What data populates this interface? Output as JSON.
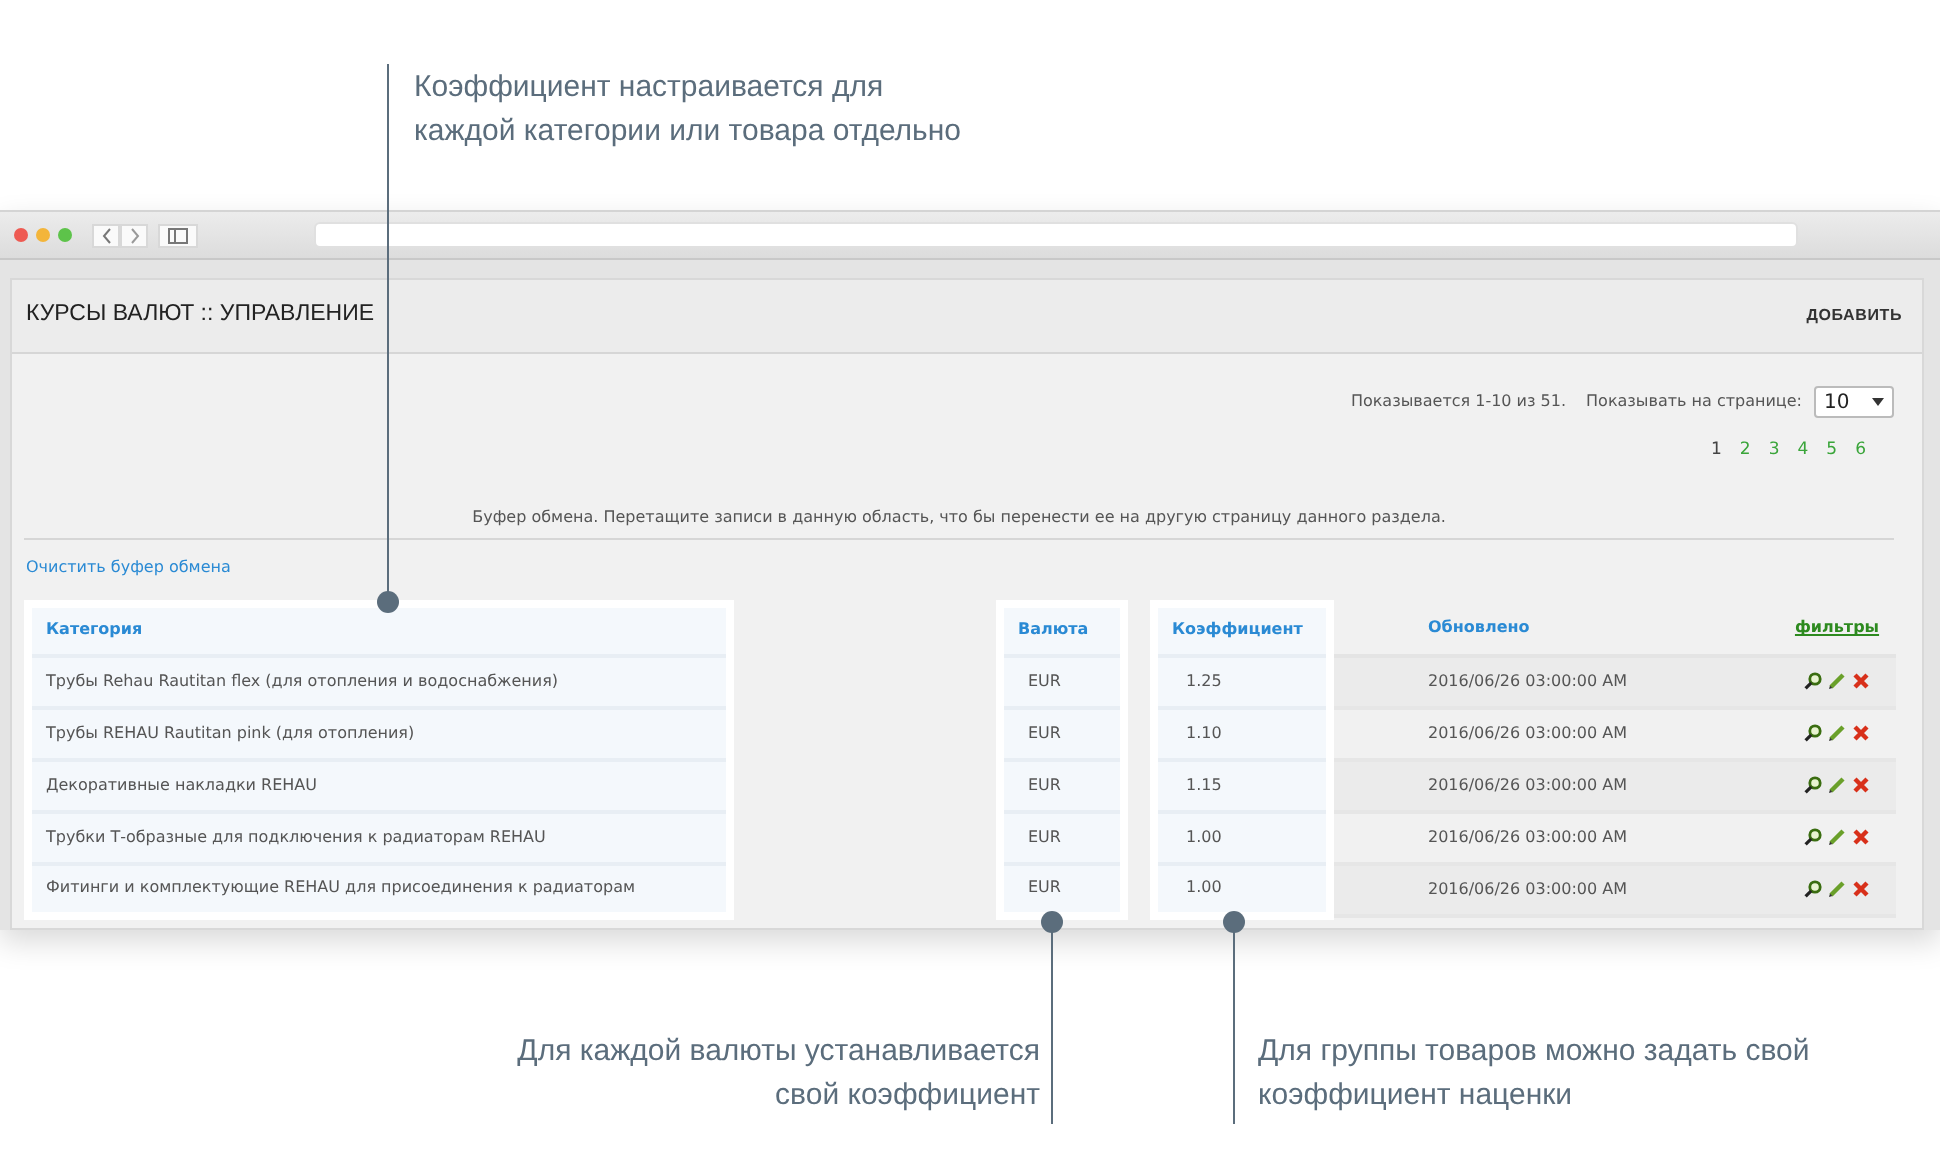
{
  "top_callout": {
    "text": "Коэффициент настраивается для\nкаждой категории или товара отдельно"
  },
  "panel": {
    "title": "КУРСЫ ВАЛЮТ :: УПРАВЛЕНИЕ",
    "add_button": "ДОБАВИТЬ",
    "summary": "Показывается 1-10 из 51.",
    "per_page_label": "Показывать на странице:",
    "per_page": "10",
    "pages": [
      {
        "label": "1",
        "selected": true
      },
      {
        "label": "2",
        "selected": false
      },
      {
        "label": "3",
        "selected": false
      },
      {
        "label": "4",
        "selected": false
      },
      {
        "label": "5",
        "selected": false
      },
      {
        "label": "6",
        "selected": false
      }
    ],
    "clipboard_note": "Буфер обмена. Перетащите записи в данную область, что бы перенести ее на другую страницу данного раздела.",
    "clear_link": "Очистить буфер обмена",
    "table": {
      "columns": [
        {
          "label": "Категория",
          "highlighted": true
        },
        {
          "label": "Валюта",
          "highlighted": true
        },
        {
          "label": "Коэффициент",
          "highlighted": true
        },
        {
          "label": "Обновлено",
          "highlighted": false
        },
        {
          "label": "фильтры",
          "highlighted": false
        }
      ],
      "rows": [
        {
          "cells": [
            "Трубы Rehau Rautitan flex (для отопления и водоснабжения)",
            "EUR",
            "1.25",
            "2016/06/26 03:00:00 AM"
          ]
        },
        {
          "cells": [
            "Трубы REHAU Rautitan pink (для отопления)",
            "EUR",
            "1.10",
            "2016/06/26 03:00:00 AM"
          ]
        },
        {
          "cells": [
            "Декоративные накладки REHAU",
            "EUR",
            "1.15",
            "2016/06/26 03:00:00 AM"
          ]
        },
        {
          "cells": [
            "Трубки Т-образные для подключения к радиаторам REHAU",
            "EUR",
            "1.00",
            "2016/06/26 03:00:00 AM"
          ]
        },
        {
          "cells": [
            "Фитинги и комплектующие REHAU для присоединения к радиаторам",
            "EUR",
            "1.00",
            "2016/06/26 03:00:00 AM"
          ]
        }
      ]
    }
  },
  "bottom_callouts": [
    {
      "text": "Для каждой валюты устанавливается\nсвой коэффициент"
    },
    {
      "text": "Для группы товаров можно задать свой\nкоэффициент наценки"
    }
  ]
}
